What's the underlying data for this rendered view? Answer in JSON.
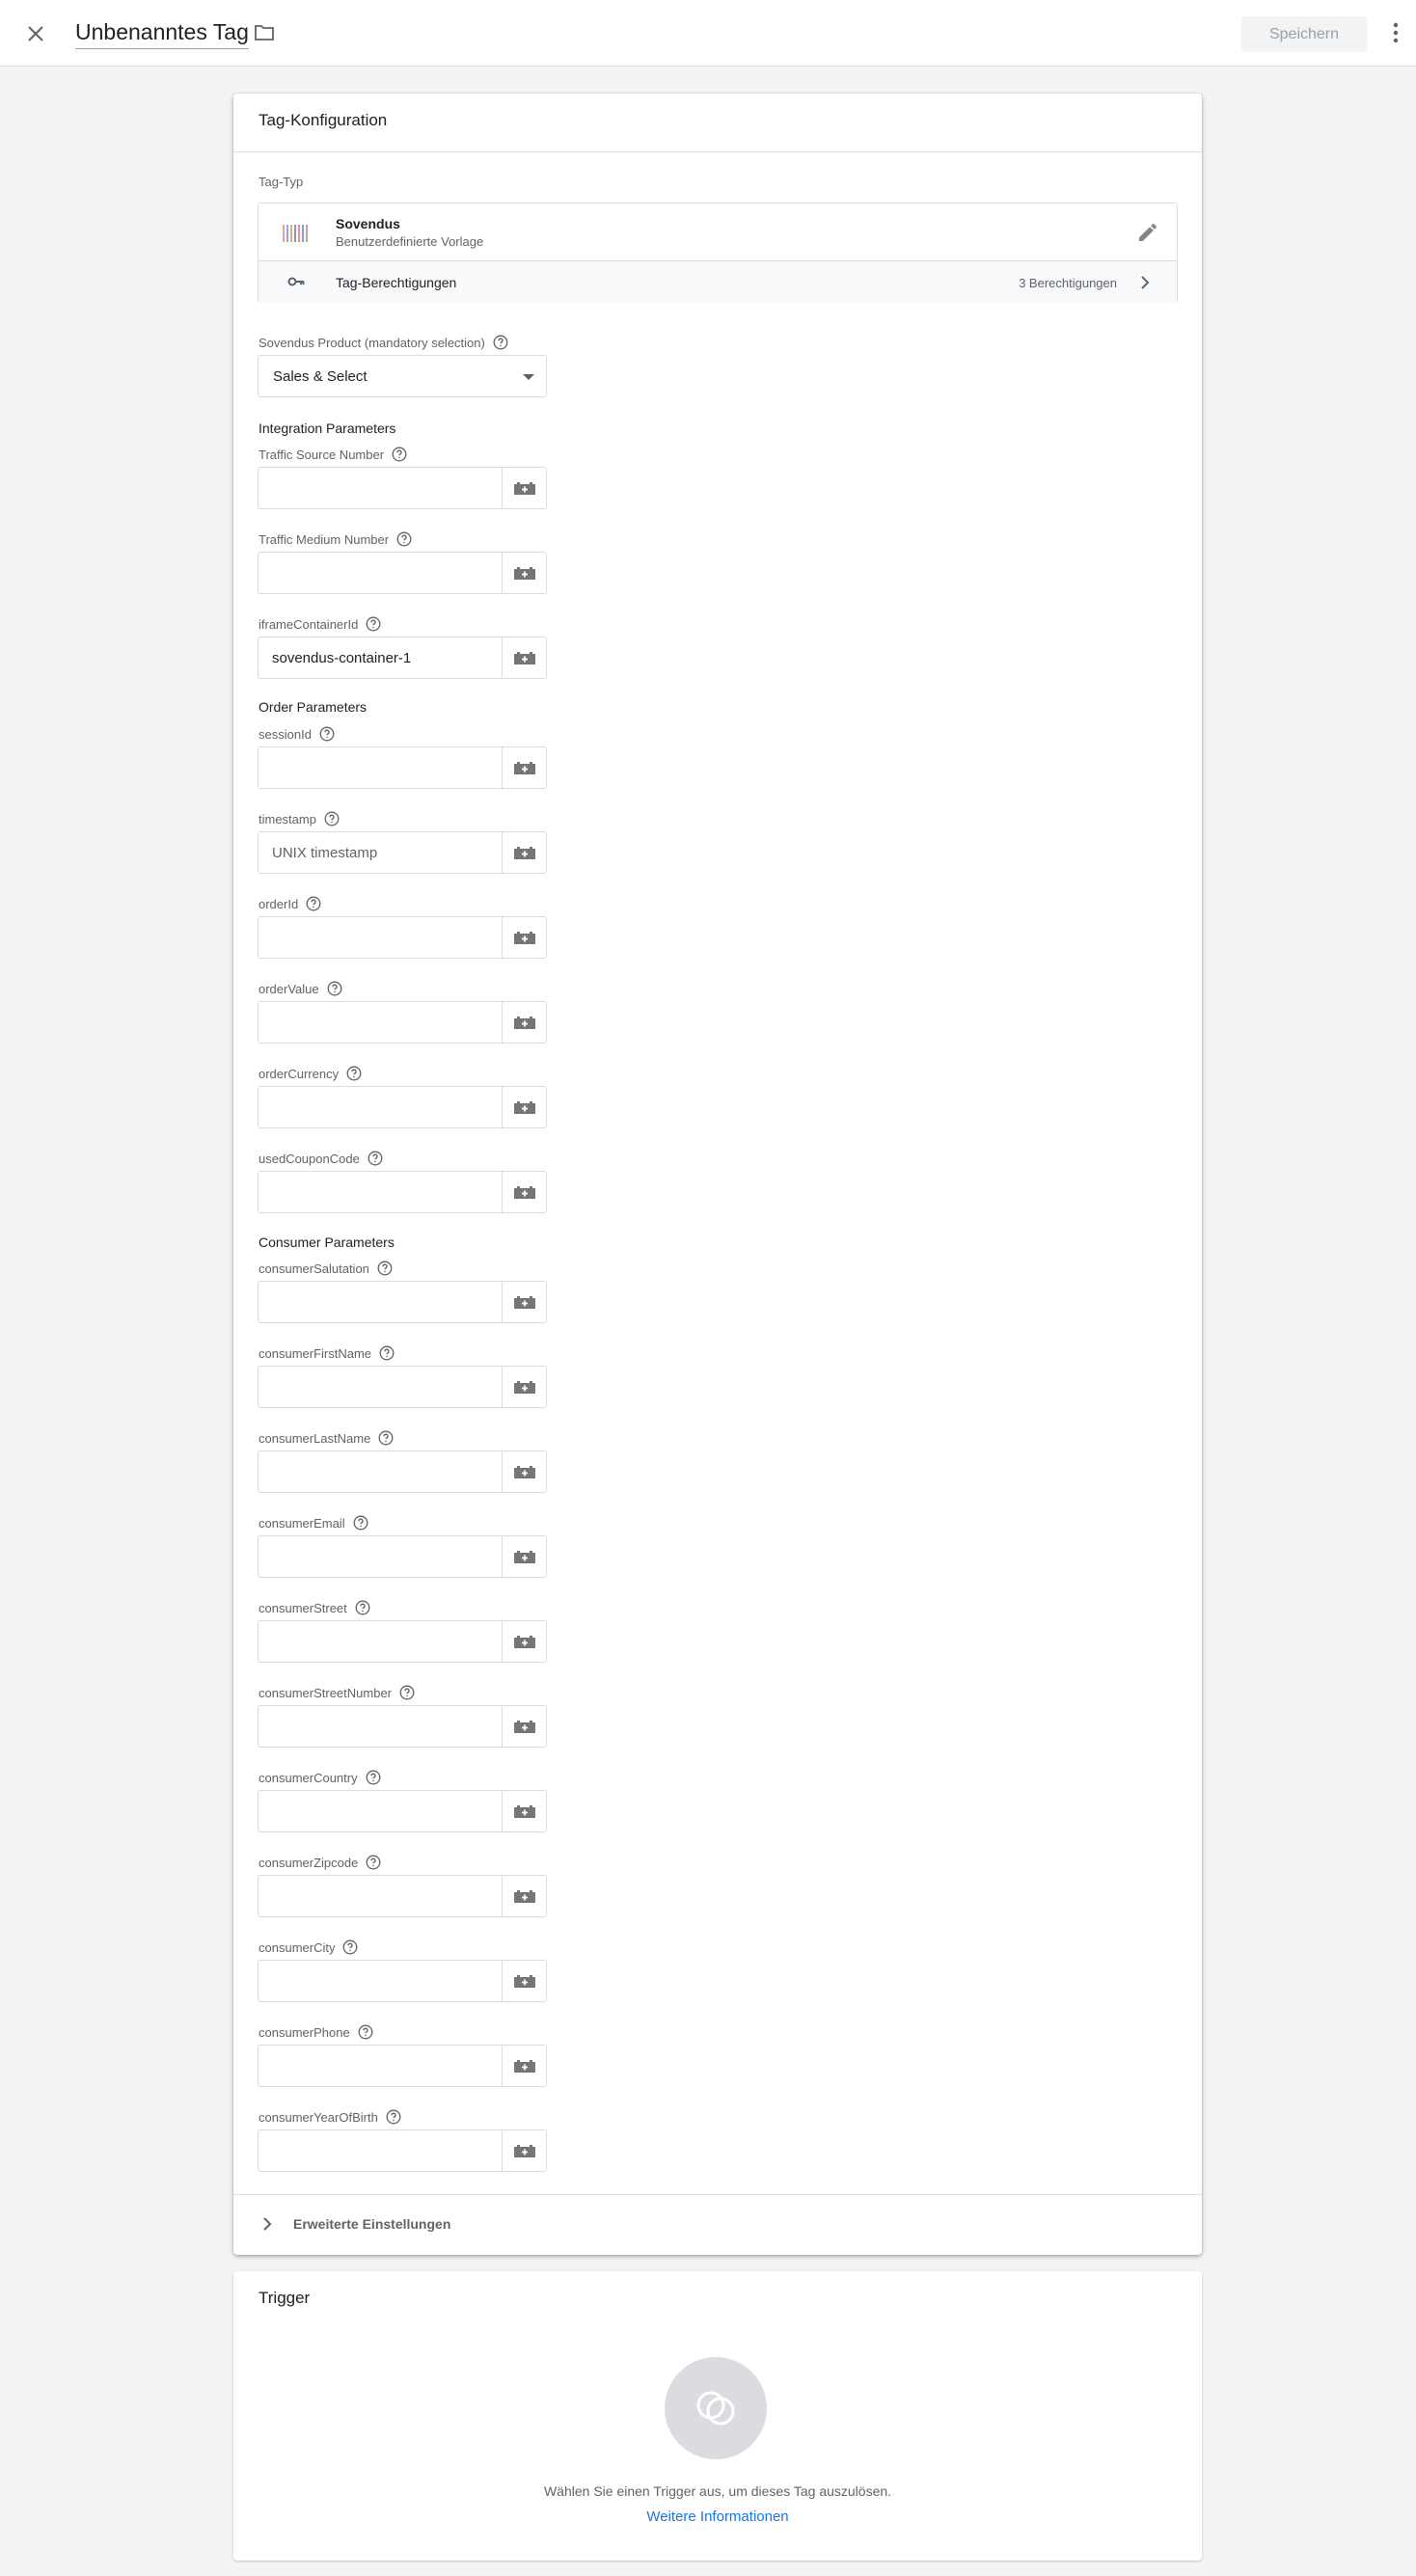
{
  "header": {
    "title": "Unbenanntes Tag",
    "save_label": "Speichern"
  },
  "config": {
    "title": "Tag-Konfiguration",
    "tag_type_label": "Tag-Typ",
    "tag_type": {
      "name": "Sovendus",
      "subtitle": "Benutzerdefinierte Vorlage",
      "permissions_label": "Tag-Berechtigungen",
      "permissions_count": "3 Berechtigungen"
    },
    "product": {
      "label": "Sovendus Product (mandatory selection)",
      "value": "Sales & Select"
    },
    "sections": {
      "integration": "Integration Parameters",
      "order": "Order Parameters",
      "consumer": "Consumer Parameters"
    },
    "fields": [
      {
        "label": "Traffic Source Number",
        "value": "",
        "placeholder": ""
      },
      {
        "label": "Traffic Medium Number",
        "value": "",
        "placeholder": ""
      },
      {
        "label": "iframeContainerId",
        "value": "sovendus-container-1",
        "placeholder": ""
      },
      {
        "label": "sessionId",
        "value": "",
        "placeholder": ""
      },
      {
        "label": "timestamp",
        "value": "",
        "placeholder": "UNIX timestamp"
      },
      {
        "label": "orderId",
        "value": "",
        "placeholder": ""
      },
      {
        "label": "orderValue",
        "value": "",
        "placeholder": ""
      },
      {
        "label": "orderCurrency",
        "value": "",
        "placeholder": ""
      },
      {
        "label": "usedCouponCode",
        "value": "",
        "placeholder": ""
      },
      {
        "label": "consumerSalutation",
        "value": "",
        "placeholder": ""
      },
      {
        "label": "consumerFirstName",
        "value": "",
        "placeholder": ""
      },
      {
        "label": "consumerLastName",
        "value": "",
        "placeholder": ""
      },
      {
        "label": "consumerEmail",
        "value": "",
        "placeholder": ""
      },
      {
        "label": "consumerStreet",
        "value": "",
        "placeholder": ""
      },
      {
        "label": "consumerStreetNumber",
        "value": "",
        "placeholder": ""
      },
      {
        "label": "consumerCountry",
        "value": "",
        "placeholder": ""
      },
      {
        "label": "consumerZipcode",
        "value": "",
        "placeholder": ""
      },
      {
        "label": "consumerCity",
        "value": "",
        "placeholder": ""
      },
      {
        "label": "consumerPhone",
        "value": "",
        "placeholder": ""
      },
      {
        "label": "consumerYearOfBirth",
        "value": "",
        "placeholder": ""
      }
    ],
    "advanced_label": "Erweiterte Einstellungen"
  },
  "trigger": {
    "title": "Trigger",
    "hint": "Wählen Sie einen Trigger aus, um dieses Tag auszulösen.",
    "link": "Weitere Informationen"
  },
  "icons": {
    "close": "close-icon",
    "folder": "folder-icon",
    "more": "more-vert-icon",
    "edit": "pencil-icon",
    "key": "key-icon",
    "help": "help-icon",
    "variable": "variable-icon",
    "chevron": "chevron-right-icon",
    "trigger": "trigger-icon"
  }
}
